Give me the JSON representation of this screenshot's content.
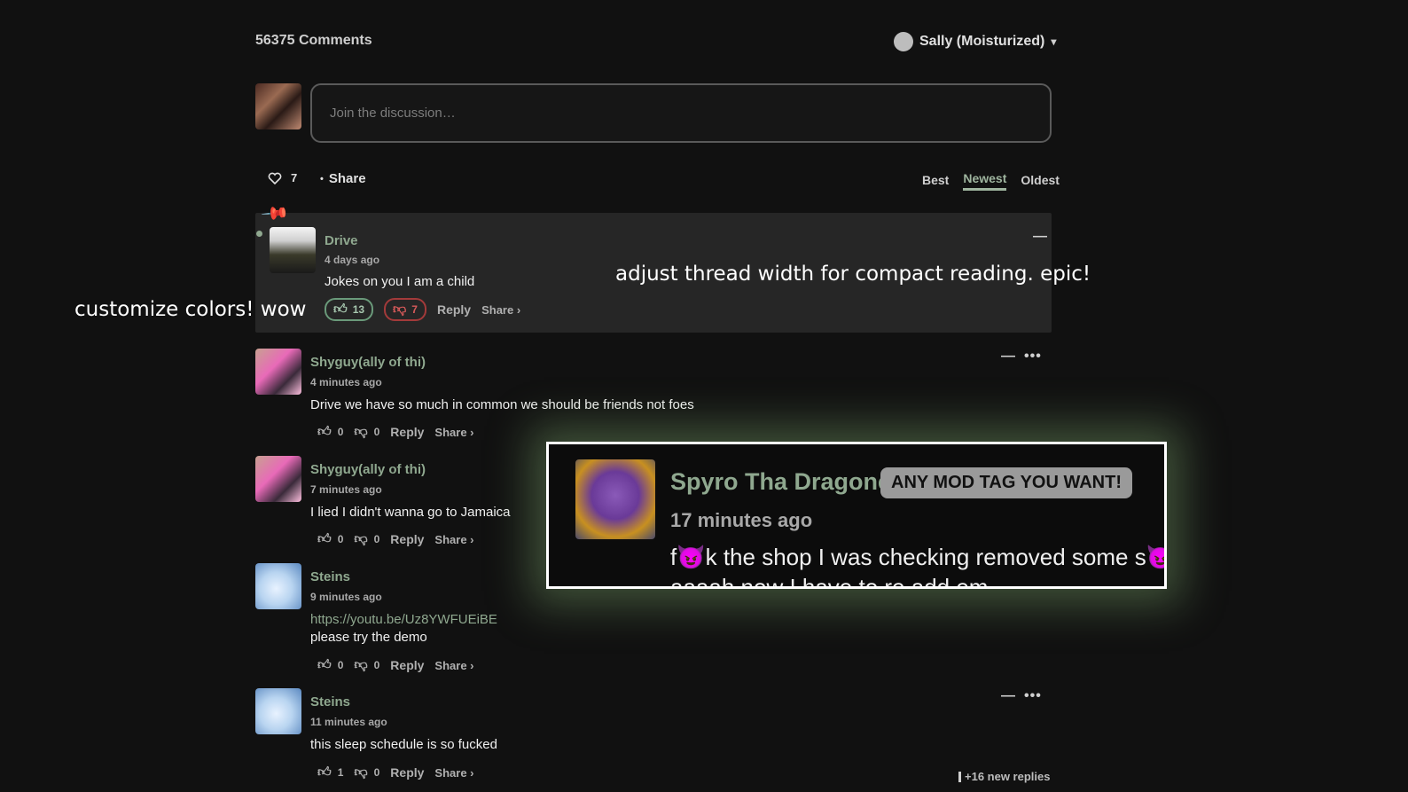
{
  "header": {
    "comment_count": "56375 Comments",
    "user_name": "Sally (Moisturized)",
    "caret": "▾"
  },
  "compose": {
    "placeholder": "Join the discussion…"
  },
  "thread_bar": {
    "like_count": "7",
    "share_label": "Share",
    "sorts": [
      "Best",
      "Newest",
      "Oldest"
    ],
    "active_sort": "Newest"
  },
  "overlays": {
    "colors": "customize colors! wow",
    "width": "adjust thread width for compact reading. epic!"
  },
  "pinned": {
    "author": "Drive",
    "time": "4 days ago",
    "text": "Jokes on you I am a child",
    "upvotes": "13",
    "downvotes": "7",
    "reply": "Reply",
    "share": "Share ›"
  },
  "comments": [
    {
      "author": "Shyguy(ally of thi)",
      "time": "4 minutes ago",
      "text": "Drive we have so much in common we should be friends not foes",
      "up": "0",
      "down": "0",
      "reply": "Reply",
      "share": "Share ›"
    },
    {
      "author": "Shyguy(ally of thi)",
      "time": "7 minutes ago",
      "text": "I lied I didn't wanna go to Jamaica",
      "up": "0",
      "down": "0",
      "reply": "Reply",
      "share": "Share ›"
    },
    {
      "author": "Steins",
      "time": "9 minutes ago",
      "link": "https://youtu.be/Uz8YWFUEiBE",
      "text": "please try the demo",
      "up": "0",
      "down": "0",
      "reply": "Reply",
      "share": "Share ›"
    },
    {
      "author": "Steins",
      "time": "11 minutes ago",
      "text": "this sleep schedule is so fucked",
      "up": "1",
      "down": "0",
      "reply": "Reply",
      "share": "Share ›"
    }
  ],
  "new_replies": "+16 new replies",
  "popup": {
    "author": "Spyro Tha Dragone",
    "tag": "ANY MOD TAG YOU WANT!",
    "time": "17 minutes ago",
    "line1": "f😈k the shop I was checking removed some s😈t",
    "line2": "aaaah now I have to re add em"
  },
  "icons": {
    "heart": "heart-icon",
    "thumb_up": "thumb-up-icon",
    "thumb_down": "thumb-down-icon",
    "pin": "pin-icon"
  },
  "colors": {
    "accent": "#8fa88f",
    "background": "#111111",
    "downvote": "#a33a3a"
  }
}
